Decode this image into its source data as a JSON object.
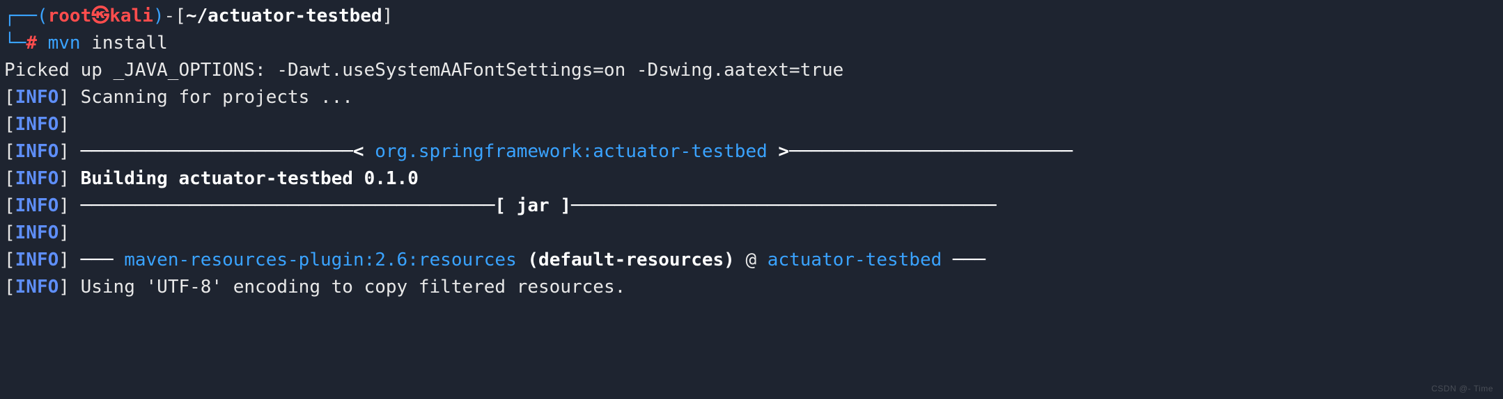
{
  "prompt": {
    "open_paren": "(",
    "user": "root",
    "skull_glyph": "㉿",
    "host": "kali",
    "close_paren": ")",
    "dash": "-",
    "open_bracket": "[",
    "cwd": "~/actuator-testbed",
    "close_bracket": "]",
    "tree_top": "┌──",
    "tree_bottom": "└─",
    "hash": "#",
    "cmd": "mvn",
    "cmd_args": "install"
  },
  "info_tag": "INFO",
  "output": {
    "java_opts": "Picked up _JAVA_OPTIONS: -Dawt.useSystemAAFontSettings=on -Dswing.aatext=true",
    "scanning": "Scanning for projects ...",
    "rule_left": "─────────────────────────< ",
    "artifact": "org.springframework:actuator-testbed",
    "rule_right": " >──────────────────────────",
    "building": "Building actuator-testbed 0.1.0",
    "jar_left": "──────────────────────────────────────[ ",
    "jar_mid": "jar",
    "jar_right": " ]───────────────────────────────────────",
    "plugin_pre_dash": "─── ",
    "plugin_name": "maven-resources-plugin:2.6:resources",
    "plugin_goal": " (default-resources)",
    "plugin_at": " @ ",
    "plugin_proj": "actuator-testbed",
    "plugin_post_dash": " ───",
    "encoding": "Using 'UTF-8' encoding to copy filtered resources."
  },
  "watermark": "CSDN @- Time"
}
